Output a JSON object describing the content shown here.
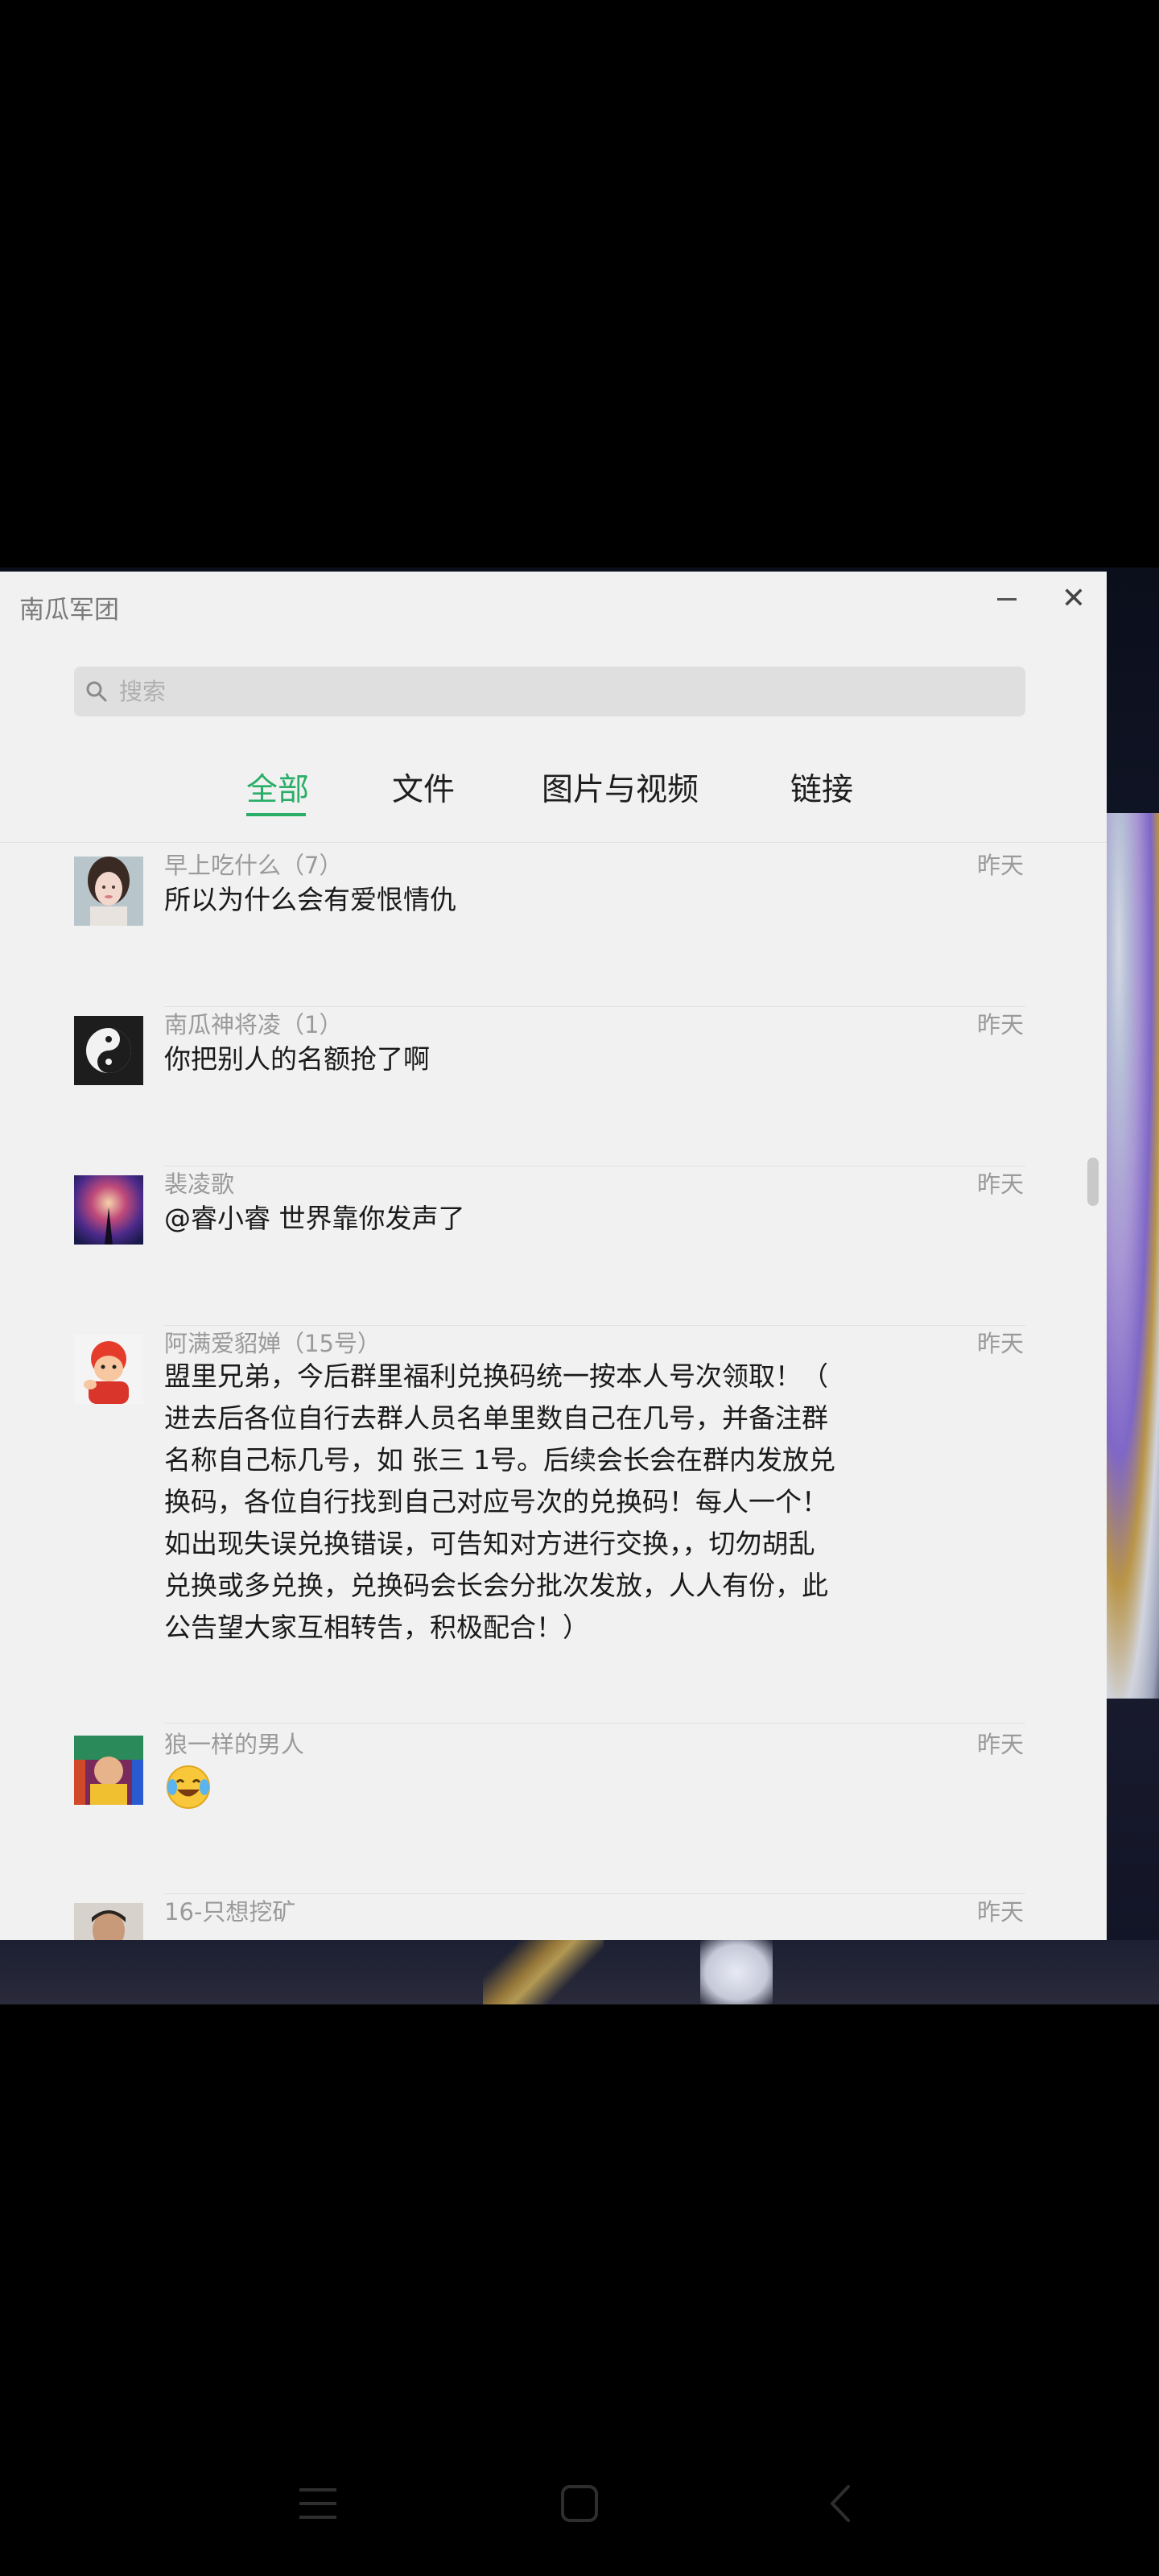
{
  "window": {
    "title": "南瓜军团",
    "minimize_icon": "minimize-icon",
    "close_glyph": "✕"
  },
  "search": {
    "placeholder": "搜索",
    "value": ""
  },
  "tabs": [
    {
      "label": "全部",
      "active": true
    },
    {
      "label": "文件",
      "active": false
    },
    {
      "label": "图片与视频",
      "active": false
    },
    {
      "label": "链接",
      "active": false
    }
  ],
  "messages": [
    {
      "sender": "早上吃什么（7）",
      "time": "昨天",
      "text": "所以为什么会有爱恨情仇",
      "avatar": "girl-avatar"
    },
    {
      "sender": "南瓜神将凌（1）",
      "time": "昨天",
      "text": "你把别人的名额抢了啊",
      "avatar": "yin-yang-avatar"
    },
    {
      "sender": "裴凌歌",
      "time": "昨天",
      "text": "@睿小睿 世界靠你发声了",
      "avatar": "galaxy-avatar"
    },
    {
      "sender": "阿满爱貂婵（15号）",
      "time": "昨天",
      "text": "盟里兄弟，今后群里福利兑换码统一按本人号次领取！（\n进去后各位自行去群人员名单里数自己在几号，并备注群\n名称自己标几号，如 张三 1号。后续会长会在群内发放兑\n换码，各位自行找到自己对应号次的兑换码！每人一个！\n如出现失误兑换错误，可告知对方进行交换，，切勿胡乱\n兑换或多兑换，兑换码会长会分批次发放，人人有份，此\n公告望大家互相转告，积极配合！）",
      "avatar": "cartoon-avatar"
    },
    {
      "sender": "狼一样的男人",
      "time": "昨天",
      "text": "",
      "emoji": "😂",
      "avatar": "colorful-avatar"
    },
    {
      "sender": "16-只想挖矿",
      "time": "昨天",
      "text": "",
      "avatar": "man-avatar"
    }
  ],
  "nav": {
    "menu_icon": "menu-icon",
    "home_icon": "home-icon",
    "back_icon": "back-icon"
  },
  "colors": {
    "accent": "#2aae67",
    "window_bg": "#f1f1f1",
    "search_bg": "#dfdfdf"
  }
}
